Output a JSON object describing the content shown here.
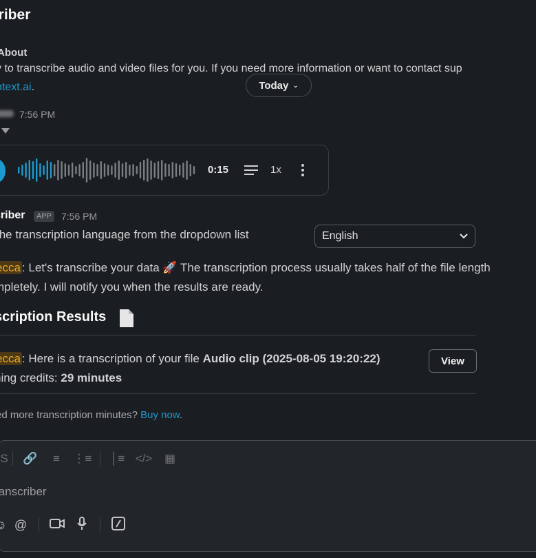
{
  "channel": {
    "title": "criber",
    "about_label": "About",
    "about_text_before": "y to transcribe audio and video files for you. If you need more information or want to contact sup",
    "about_link": "ntext.ai",
    "about_text_after": "."
  },
  "date_divider": {
    "label": "Today"
  },
  "user_message": {
    "time": "7:56 PM",
    "audio": {
      "duration": "0:15",
      "speed": "1x"
    }
  },
  "bot_message": {
    "sender": "criber",
    "badge": "APP",
    "time": "7:56 PM",
    "choose_text": "the transcription language from the dropdown list",
    "language_selected": "English",
    "mention": "ecca",
    "process_text": ": Let's transcribe your data 🚀 The transcription process usually takes half of the file length",
    "process_text_2": "mpletely. I will notify you when the results are ready.",
    "results_title": "scription Results",
    "result_mention": "ecca",
    "result_text": ": Here is a transcription of your file ",
    "result_file": "Audio clip (2025-08-05 19:20:22)",
    "credits_label": "ning credits: ",
    "credits_value": "29 minutes",
    "view_button": "View",
    "need_more_text": "ed more transcription minutes? ",
    "buy_link": "Buy now",
    "buy_after": "."
  },
  "composer": {
    "placeholder": "ranscriber"
  },
  "colors": {
    "accent": "#1d9bd1",
    "mention_bg": "#4d3a14",
    "mention_fg": "#e8a72b",
    "background": "#1a1d21"
  }
}
